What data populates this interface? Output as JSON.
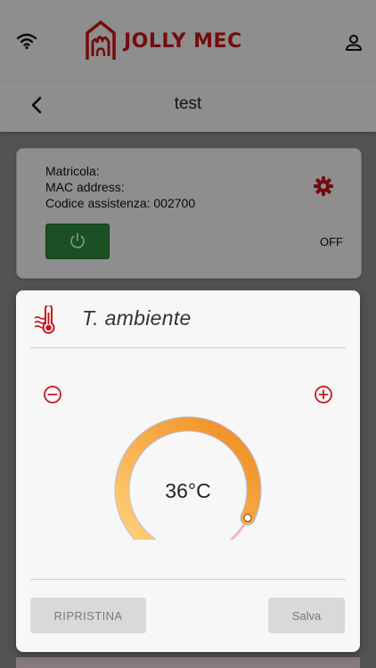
{
  "header": {
    "brand": "JOLLY MEC",
    "icons": {
      "wifi": "wifi-icon",
      "user": "user-icon",
      "logo": "jolly-mec-logo"
    }
  },
  "nav": {
    "title": "test",
    "back_icon": "chevron-left-icon"
  },
  "device": {
    "matricola_label": "Matricola:",
    "mac_label": "MAC address:",
    "codice_label": "Codice assistenza: 002700",
    "status": "OFF",
    "power_icon": "power-icon",
    "settings_icon": "gear-icon"
  },
  "dialog": {
    "title": "T. ambiente",
    "icon": "thermometer-icon",
    "temperature": "36°C",
    "gauge_fraction": 0.9,
    "reset_label": "RIPRISTINA",
    "save_label": "Salva"
  },
  "colors": {
    "brand_red": "#c8161d",
    "power_green": "#2e8b3e",
    "gauge_start": "#ffd27a",
    "gauge_end": "#ef8a1e"
  }
}
